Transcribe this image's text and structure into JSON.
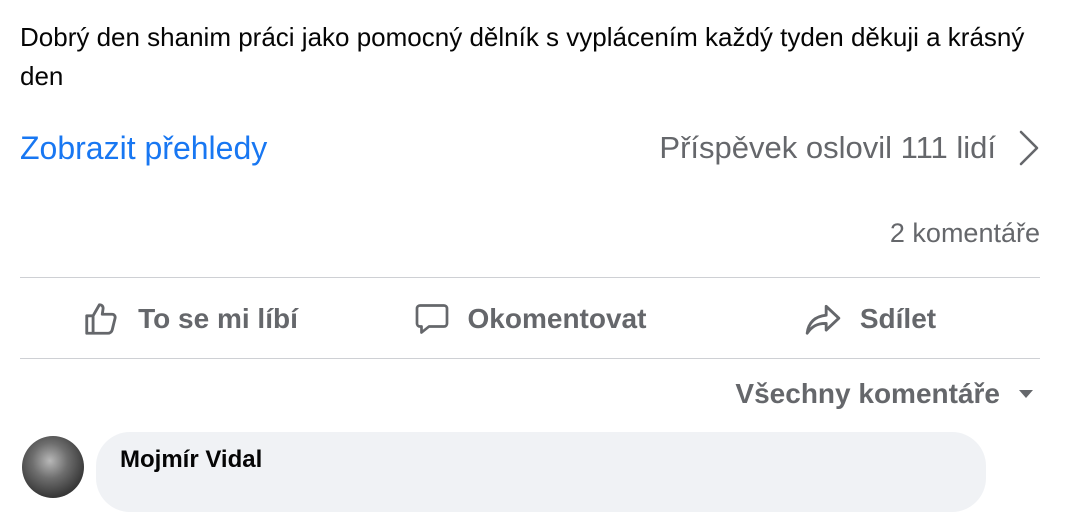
{
  "post": {
    "text": "Dobrý den shanim práci jako pomocný dělník s vyplácením každý tyden děkuji a krásný den"
  },
  "insights": {
    "link_label": "Zobrazit přehledy",
    "reach_text": "Příspěvek oslovil 111 lidí"
  },
  "comments_count_label": "2 komentáře",
  "actions": {
    "like_label": "To se mi líbí",
    "comment_label": "Okomentovat",
    "share_label": "Sdílet"
  },
  "comments_sort": {
    "label": "Všechny komentáře"
  },
  "first_comment": {
    "author": "Mojmír Vidal"
  },
  "colors": {
    "link": "#1877f2",
    "secondary_text": "#65676b",
    "divider": "#ced0d4",
    "bubble": "#f0f2f5"
  }
}
